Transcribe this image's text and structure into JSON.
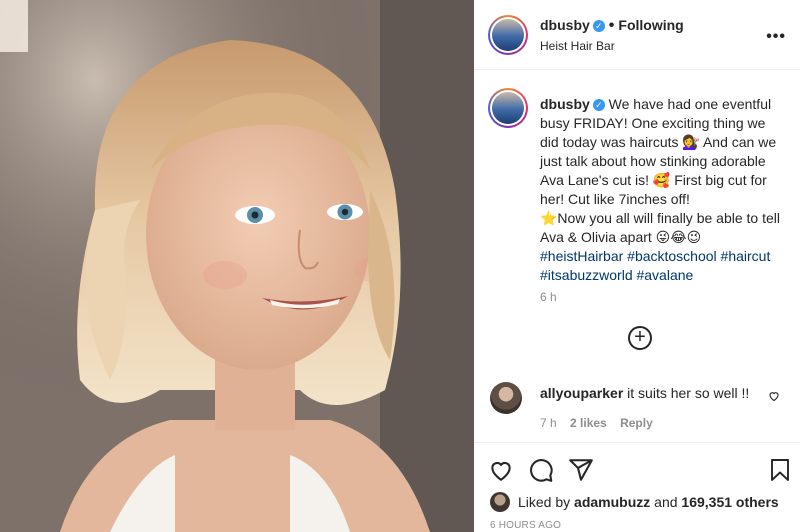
{
  "post": {
    "author": {
      "username": "dbusby",
      "verified_mark": "✓",
      "follow_separator": "•",
      "follow_status": "Following",
      "location": "Heist Hair Bar"
    },
    "caption": {
      "username": "dbusby",
      "lines": [
        "We have had one eventful busy FRIDAY! One exciting thing we did today was haircuts 💇‍♀️ And can we just talk about how stinking adorable Ava Lane's cut is! 🥰 First big cut for her! Cut like 7inches off!",
        "⭐Now you all will finally be able to tell Ava & Olivia apart 😜😂😉"
      ],
      "hashtags": "#heistHairbar #backtoschool #haircut #itsabuzzworld #avalane",
      "time": "6 h"
    },
    "load_more_icon": "plus-circle-icon",
    "comment": {
      "username": "allyouparker",
      "text": "it suits her so well !!",
      "time": "7 h",
      "likes": "2 likes",
      "reply": "Reply"
    },
    "likes": {
      "prefix": "Liked by",
      "user": "adamubuzz",
      "middle": "and",
      "others": "169,351 others"
    },
    "timestamp": "6 HOURS AGO",
    "icons": [
      "heart-icon",
      "comment-icon",
      "share-icon",
      "bookmark-icon",
      "more-options-icon"
    ],
    "colors": {
      "link": "#00376b",
      "verified": "#3897f0",
      "muted": "#8e8e8e",
      "text": "#262626"
    }
  }
}
